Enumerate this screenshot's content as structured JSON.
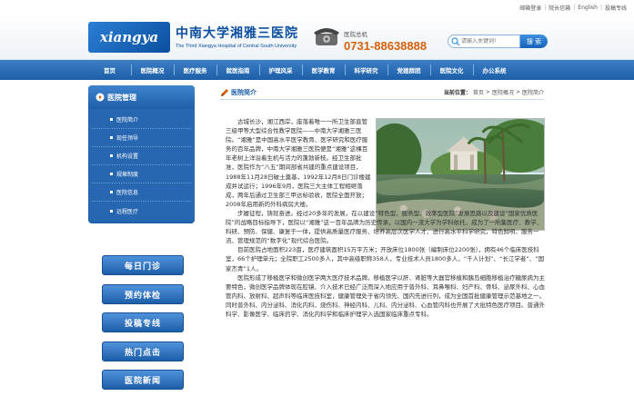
{
  "toplinks": [
    "邮箱登录",
    "院长信箱",
    "English",
    "投稿专线"
  ],
  "logo": {
    "badge": "xiangya",
    "name_cn": "中南大学湘雅三医院",
    "name_en": "The Third Xiangya Hospital of Central South University"
  },
  "phone": {
    "label": "医院总机",
    "number": "0731-88638888"
  },
  "search": {
    "placeholder": "请输入关键词!",
    "button": "搜 索"
  },
  "nav": [
    "首页",
    "医院概况",
    "医疗服务",
    "就医指南",
    "护理风采",
    "医学教育",
    "科学研究",
    "党建群团",
    "医院文化",
    "办公系统"
  ],
  "sidebar": {
    "title": "医院管理",
    "items": [
      "医院简介",
      "现任领导",
      "机构设置",
      "规章制度",
      "医院信息",
      "远程医疗"
    ]
  },
  "quick_links": [
    "每日门诊",
    "预约体检",
    "投稿专线",
    "热门点击",
    "医院新闻"
  ],
  "main": {
    "title": "医院简介",
    "breadcrumb_label": "当前位置：",
    "breadcrumb": [
      "首页",
      "医院概况",
      "医院简介"
    ]
  },
  "article": {
    "p1": "古城长沙，湘江西岸，座落着唯一一所卫生部直管三级甲等大型综合性教学医院——中南大学湘雅三医院。“湘雅”是中国高水平医学教育、医学研究和医疗服务的百年品牌，中南大学湘雅三医院便是“湘雅”这棵百年老树上洋溢着生机与活力的蓬勃新枝。经卫生部批准，医院作为“八五”期间部省共建的重点建设项目，1988年11月28日破土奠基，1992年12月8日门诊楼建成并试运行；1996年9月，医院三大主体工程相继落成，两年后通过卫生部三甲达标验收，医院全面开放；2008年启用新的外科病房大楼。",
    "p2": "步履征程，铸就奋进。经过20多年的发展，在以建设“特色型、服务型、效率型医院”发展思路以及建设“国家优质医院”的战略目标指导下，医院以“湘雅”这一百年品牌为历史传承，以国内一流大学为学科依托，成为了一所集医疗、教学、科研、预防、保健、康复于一体，提供高质量医疗服务、培养高层次医学人才、进行高水平科学研究，特色鲜明、服务一流、管理规范的“数字化”现代综合医院。",
    "p3": "目前医院占地面积223亩，医疗建筑面积15万平方米；开放床位1800张（编制床位2200张），拥有46个临床医技科室，66个护理单元；全院职工2500多人，其中高级职称358人，专业技术人员1800多人，“千人计划”、“长江学者”、“国家杰青”1人。",
    "p4": "医院形成了移植医学和微创医学两大医疗技术品牌。移植医学以肝、肾脏等大器官移植和胰岛细胞移植治疗糖尿病为主要特色，微创医学品牌体现在腔镜、介入技术已经广泛而深入地应用于普外科、耳鼻喉科、妇产科、骨科、泌尿外科、心血管内科、放射科、超声科等临床医技科室，健康管理处于省内领先、国内先进行列，成为全国首批健康管理示范基地之一。同时普外科、内分泌科、消化内科、烧伤科、神经内科、儿科、内分泌科、心血管内科也开展了大批特色医疗项目。普通外科学、影像医学、临床药学、消化内科学和临床护理学入选国家临床重点专科。"
  }
}
